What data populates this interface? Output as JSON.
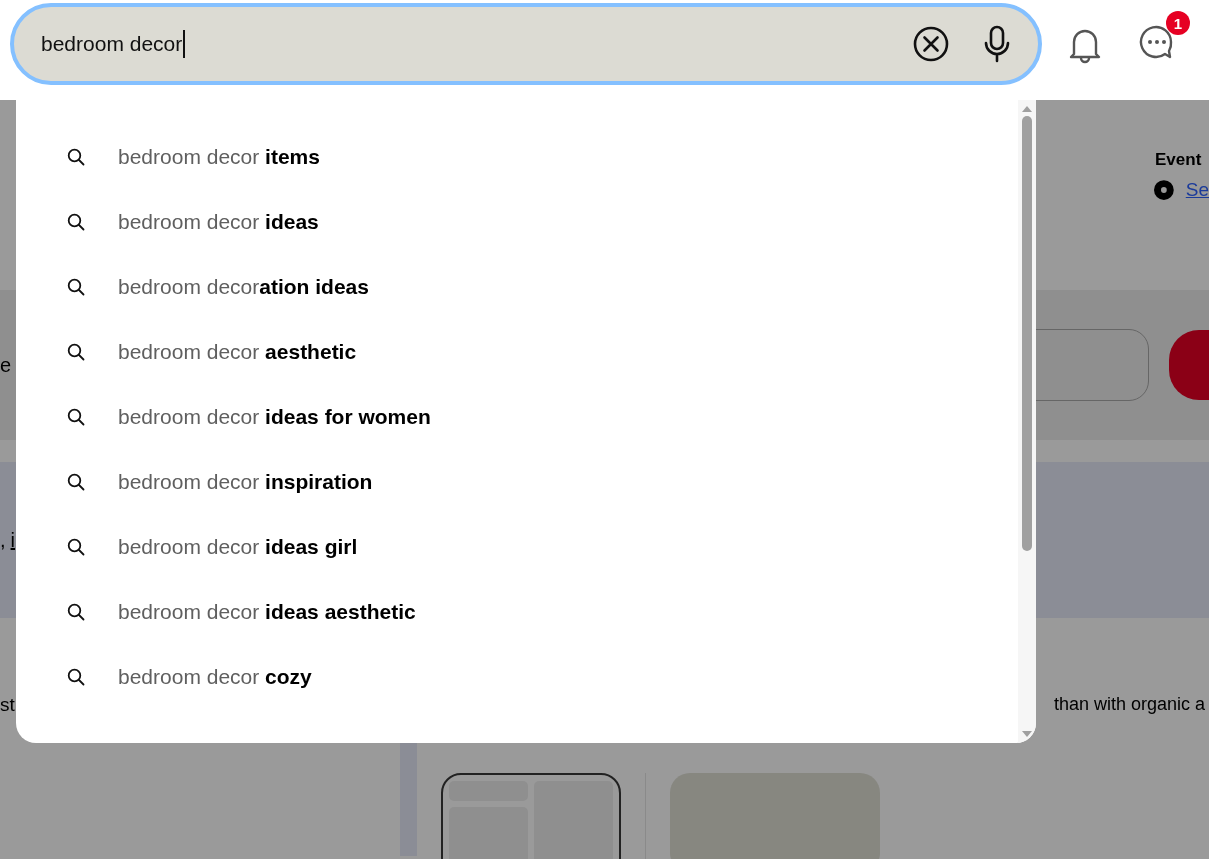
{
  "search": {
    "value": "bedroom decor"
  },
  "notifications": {
    "badge": "1"
  },
  "suggestions": [
    {
      "text": "bedroom decor **items**"
    },
    {
      "text": "bedroom decor **ideas**"
    },
    {
      "text": "bedroom decor**ation ideas**"
    },
    {
      "text": "bedroom decor **aesthetic**"
    },
    {
      "text": "bedroom decor **ideas for women**"
    },
    {
      "text": "bedroom decor **inspiration**"
    },
    {
      "text": "bedroom decor **ideas girl**"
    },
    {
      "text": "bedroom decor **ideas aesthetic**"
    },
    {
      "text": "bedroom decor **cozy**"
    }
  ],
  "background": {
    "event_heading": "Event",
    "event_link": "Se",
    "left_fragment_1": "e",
    "left_fragment_2": ",",
    "left_link": "i",
    "left_fragment_3": "st",
    "right_fragment": "than with organic a"
  }
}
